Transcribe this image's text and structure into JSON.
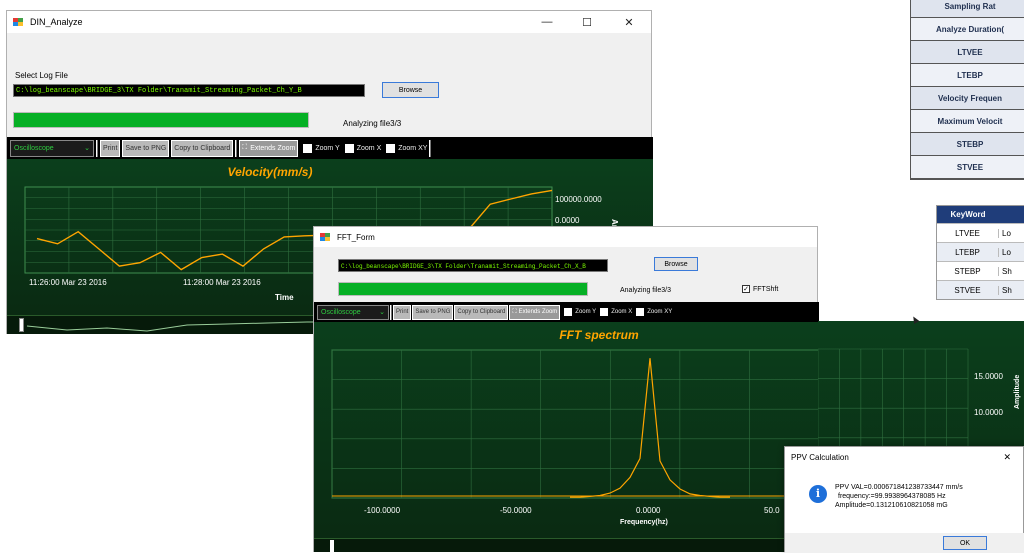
{
  "din": {
    "title": "DIN_Analyze",
    "select_label": "Select Log File",
    "path": "C:\\log_beanscape\\BRIDGE_3\\TX Folder\\Tranamit_Streaming_Packet_Ch_Y_B",
    "browse": "Browse",
    "status": "Analyzing file3/3",
    "progress": 1.0,
    "toolbar": {
      "mode": "Oscilloscope",
      "print": "Print",
      "png": "Save to PNG",
      "clip": "Copy to Clipboard",
      "extend": "Extends Zoom",
      "zy": "Zoom Y",
      "zx": "Zoom X",
      "zxy": "Zoom XY"
    },
    "chart_title": "Velocity(mm/s)",
    "y_ticks": [
      "100000.0000",
      "0.0000"
    ],
    "x_ticks": [
      "11:26:00 Mar 23 2016",
      "11:28:00 Mar 23 2016"
    ],
    "xlabel": "Time",
    "ylabel": "Amplitude"
  },
  "fft": {
    "title": "FFT_Form",
    "path": "C:\\log_beanscape\\BRIDGE_3\\TX Folder\\Tranamit_Streaming_Packet_Ch_X_B",
    "browse": "Browse",
    "status": "Analyzing file3/3",
    "progress": 1.0,
    "fftshift": "FFTShft",
    "toolbar": {
      "mode": "Oscilloscope",
      "print": "Print",
      "png": "Save to PNG",
      "clip": "Copy to Clipboard",
      "extend": "Extends Zoom",
      "zy": "Zoom Y",
      "zx": "Zoom X",
      "zxy": "Zoom XY"
    },
    "chart_title": "FFT spectrum",
    "y_ticks": [
      "15.0000",
      "10.0000"
    ],
    "x_ticks": [
      "-100.0000",
      "-50.0000",
      "0.0000",
      "50.0"
    ],
    "xlabel": "Frequency(hz)",
    "ylabel": "Amplitude"
  },
  "ppv": {
    "title": "PPV Calculation",
    "lines": [
      "PPV VAL=0.000671841238733447 mm/s",
      "frequency:=99.9938964378085 Hz",
      "Amplitude=0.131210610821058 mG"
    ],
    "ok": "OK",
    "close": "✕"
  },
  "table1": {
    "rows": [
      "Sampling Rat",
      "Analyze Duration(",
      "LTVEE",
      "LTEBP",
      "Velocity Frequen",
      "Maximum Velocit",
      "STEBP",
      "STVEE"
    ]
  },
  "table2": {
    "header": [
      "KeyWord",
      ""
    ],
    "rows": [
      [
        "LTVEE",
        "Lo"
      ],
      [
        "LTEBP",
        "Lo"
      ],
      [
        "STEBP",
        "Sh"
      ],
      [
        "STVEE",
        "Sh"
      ]
    ]
  },
  "icons": {
    "min": "—",
    "max": "☐",
    "close": "✕",
    "info": "i",
    "chev": "⌄"
  },
  "chart_data": [
    {
      "type": "line",
      "title": "Velocity(mm/s)",
      "xlabel": "Time",
      "ylabel": "Amplitude",
      "x_tick_labels": [
        "11:26:00 Mar 23 2016",
        "11:28:00 Mar 23 2016"
      ],
      "y_tick_labels": [
        "100000.0000",
        "0.0000"
      ],
      "series": [
        {
          "values": [
            -40000,
            -55000,
            -20000,
            -70000,
            -120000,
            -110000,
            -80000,
            -130000,
            -95000,
            -85000,
            -120000,
            -70000,
            -35000,
            -32000,
            -30000,
            -28000,
            -27000,
            -25000,
            -23000,
            -20000,
            -18000,
            -10000,
            60000,
            75000,
            90000,
            100000
          ]
        }
      ]
    },
    {
      "type": "line",
      "title": "FFT spectrum",
      "xlabel": "Frequency(hz)",
      "ylabel": "Amplitude",
      "x_tick_labels": [
        "-100.0000",
        "-50.0000",
        "0.0000",
        "50.0"
      ],
      "y_tick_labels": [
        "15.0000",
        "10.0000"
      ],
      "series": [
        {
          "values": [
            0.1,
            0.1,
            0.2,
            0.3,
            0.6,
            1.2,
            2.5,
            4.8,
            17.0,
            4.5,
            2.2,
            1.1,
            0.5,
            0.3,
            0.2,
            0.1,
            0.1
          ]
        }
      ]
    }
  ]
}
